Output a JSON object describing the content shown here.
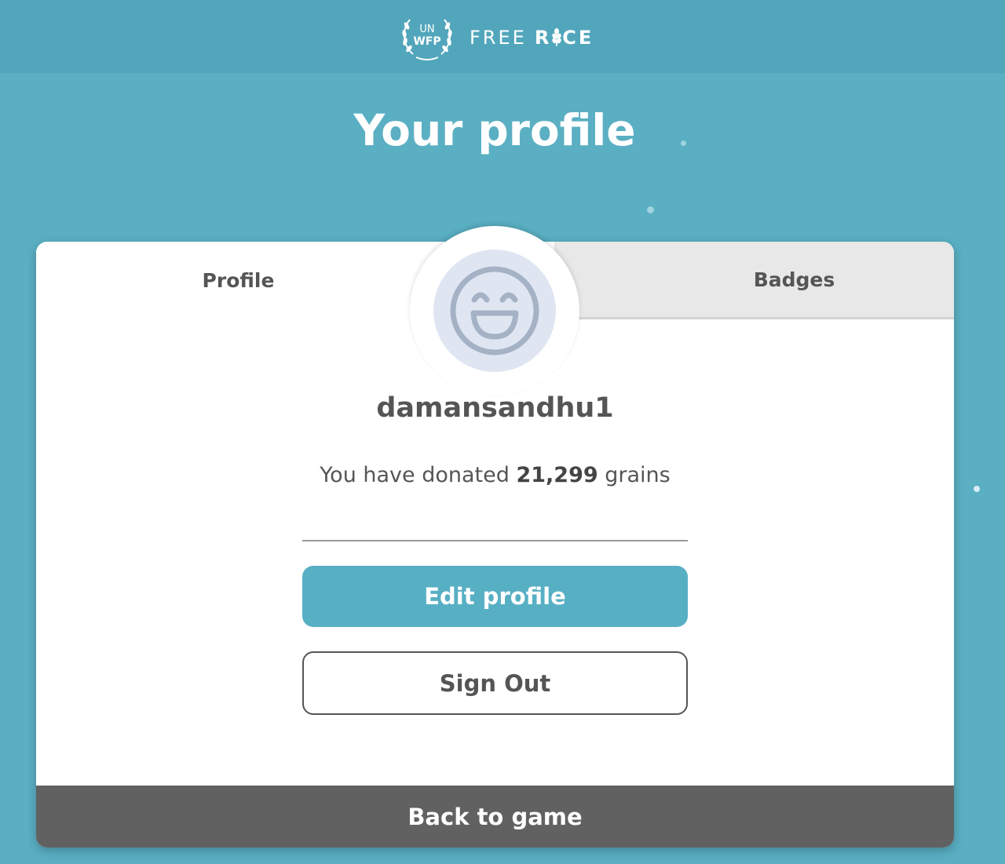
{
  "header": {
    "logo_org_top": "UN",
    "logo_org_bottom": "WFP",
    "brand_light": "FREE",
    "brand_bold_left": "R",
    "brand_bold_right": "CE"
  },
  "page": {
    "title": "Your profile"
  },
  "tabs": {
    "profile_label": "Profile",
    "badges_label": "Badges",
    "active": "Profile"
  },
  "profile": {
    "username": "damansandhu1",
    "donated_prefix": "You have donated",
    "donated_amount": "21,299",
    "donated_suffix": "grains",
    "avatar_icon": "grinning-face-icon"
  },
  "actions": {
    "edit_label": "Edit profile",
    "signout_label": "Sign Out",
    "back_label": "Back to game"
  },
  "colors": {
    "background": "#5aafc3",
    "header": "#52a6bc",
    "accent_button": "#57afc4",
    "back_bar": "#616161",
    "text_dark": "#555555"
  }
}
